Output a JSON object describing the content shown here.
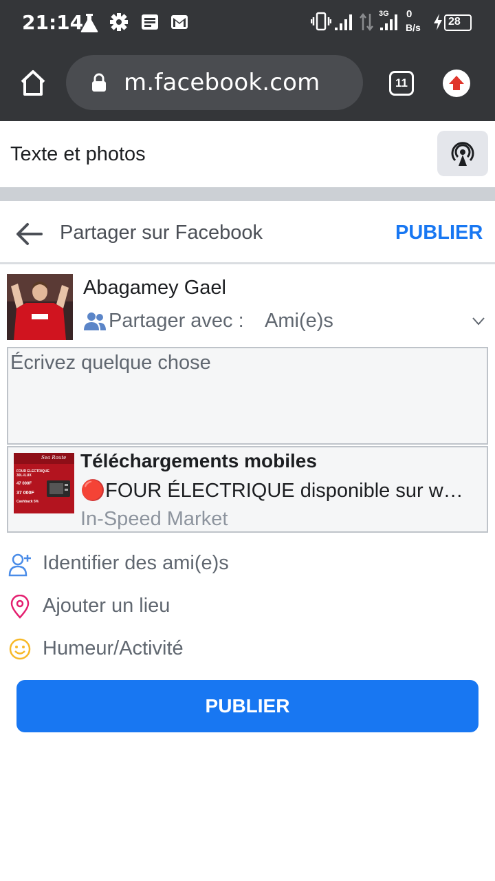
{
  "status_bar": {
    "time": "21:14",
    "net_speed_value": "0",
    "net_speed_unit": "B/s",
    "network_type": "3G",
    "battery": "28"
  },
  "browser": {
    "url": "m.facebook.com",
    "tab_count": "11"
  },
  "page": {
    "section_title": "Texte et photos"
  },
  "share_header": {
    "title": "Partager sur Facebook",
    "publish_label": "PUBLIER"
  },
  "user": {
    "name": "Abagamey Gael",
    "audience_label": "Partager avec :",
    "audience_value": "Ami(e)s"
  },
  "composer": {
    "placeholder": "Écrivez quelque chose"
  },
  "link_preview": {
    "title": "Téléchargements mobiles",
    "description": "🔴FOUR ÉLECTRIQUE disponible sur w…",
    "source": "In-Speed Market",
    "thumb_texts": {
      "brand": "Sea Route",
      "product": "FOUR ELECTRIQUE 30L-ILUX",
      "price_old": "47 000F",
      "price_new": "37 000F",
      "badge": "Cashback 5%"
    }
  },
  "actions": [
    {
      "label": "Identifier des ami(e)s",
      "icon": "add-person-icon"
    },
    {
      "label": "Ajouter un lieu",
      "icon": "location-pin-icon"
    },
    {
      "label": "Humeur/Activité",
      "icon": "smiley-icon"
    }
  ],
  "publish_button": {
    "label": "PUBLIER"
  },
  "colors": {
    "accent": "#1877f2",
    "browser_bar": "#343639",
    "pin": "#e41e3f",
    "smiley": "#f7b928"
  }
}
